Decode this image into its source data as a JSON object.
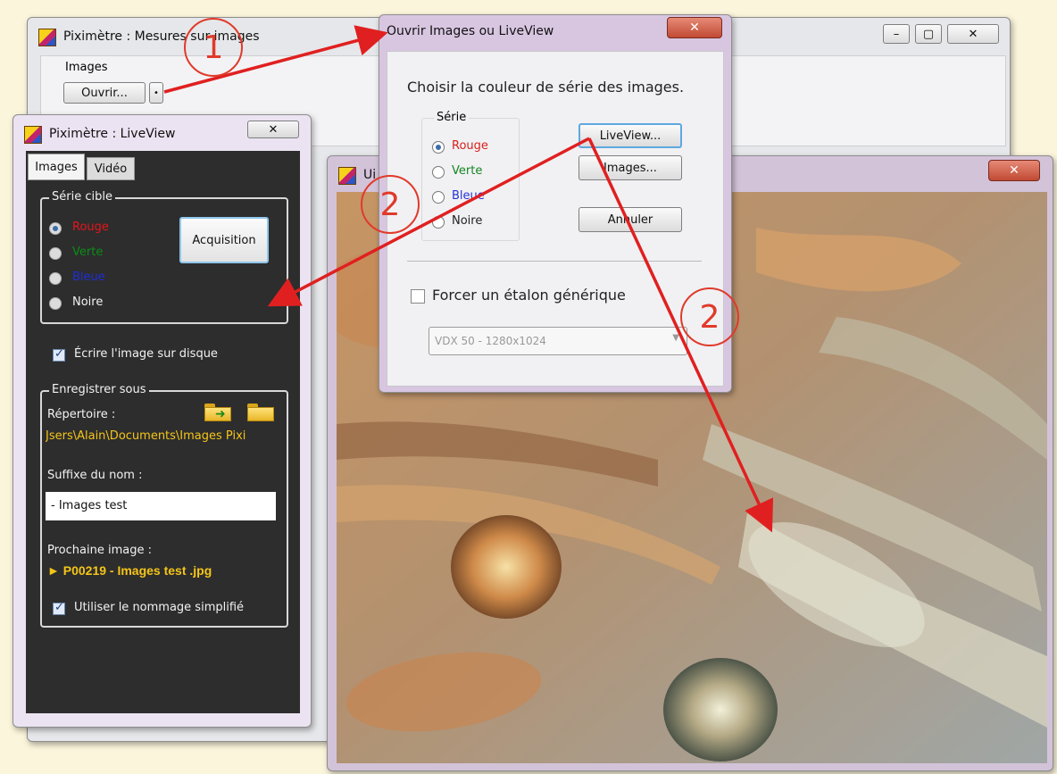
{
  "main_window": {
    "title": "Piximètre : Mesures sur images",
    "group_label": "Images",
    "open_button": "Ouvrir...",
    "small_button": "•",
    "controls": [
      "–",
      "▢",
      "✕"
    ]
  },
  "liveview": {
    "title": "Piximètre : LiveView",
    "close": "✕",
    "tabs": [
      "Images",
      "Vidéo"
    ],
    "serie_label": "Série cible",
    "series": [
      {
        "label": "Rouge",
        "color": "#e3151b",
        "selected": true
      },
      {
        "label": "Verte",
        "color": "#0a8d18",
        "selected": false
      },
      {
        "label": "Bleue",
        "color": "#1f2ed6",
        "selected": false
      },
      {
        "label": "Noire",
        "color": "#f2f2f2",
        "selected": false
      }
    ],
    "acquisition": "Acquisition",
    "write_disk": "Écrire l'image sur disque",
    "save_as": "Enregistrer sous",
    "directory_label": "Répertoire :",
    "directory_path": "Jsers\\Alain\\Documents\\Images Pixi",
    "suffix_label": "Suffixe du nom :",
    "suffix_value": "- Images test",
    "next_label": "Prochaine image :",
    "next_value": "► P00219 - Images test .jpg",
    "simplified": "Utiliser le nommage simplifié"
  },
  "dialog": {
    "title": "Ouvrir Images ou LiveView",
    "close": "✕",
    "heading": "Choisir la couleur de série des images.",
    "serie_label": "Série",
    "series": [
      {
        "label": "Rouge",
        "color": "#d8201c",
        "selected": true
      },
      {
        "label": "Verte",
        "color": "#13851f",
        "selected": false
      },
      {
        "label": "Bleue",
        "color": "#2432d8",
        "selected": false
      },
      {
        "label": "Noire",
        "color": "#222222",
        "selected": false
      }
    ],
    "liveview_button": "LiveView...",
    "images_button": "Images...",
    "cancel_button": "Annuler",
    "force_label": "Forcer un étalon générique",
    "camera": "VDX 50 - 1280x1024"
  },
  "image_window": {
    "title": "Ui",
    "close": "✕"
  },
  "annotations": {
    "one": "1",
    "two": "2"
  },
  "colors": {
    "arrow": "#e02020",
    "panel_dark": "#2d2d2d",
    "accent_yellow": "#f5c518"
  }
}
